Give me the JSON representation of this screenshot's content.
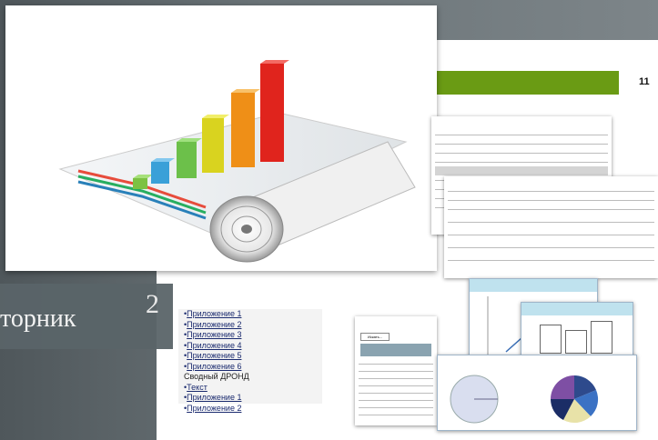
{
  "slide": {
    "title": "торник",
    "title_fragment": "2",
    "page_number": "11"
  },
  "doc_list": {
    "items": [
      {
        "label": "Приложение 1",
        "link": true
      },
      {
        "label": "Приложение 2",
        "link": true
      },
      {
        "label": "Приложение 3",
        "link": true
      },
      {
        "label": "Приложение 4",
        "link": true
      },
      {
        "label": "Приложение 5",
        "link": true
      },
      {
        "label": "Приложение 6",
        "link": true
      },
      {
        "label": "Сводный ДРОНД",
        "link": false
      },
      {
        "label": "Текст",
        "link": true
      },
      {
        "label": "Приложение 1",
        "link": true
      },
      {
        "label": "Приложение 2",
        "link": true
      }
    ]
  },
  "doc_form": {
    "button_label": "Искать..."
  },
  "colors": {
    "accent_green": "#6a9b14",
    "background": "#5c6468",
    "link": "#1a2a6e"
  }
}
